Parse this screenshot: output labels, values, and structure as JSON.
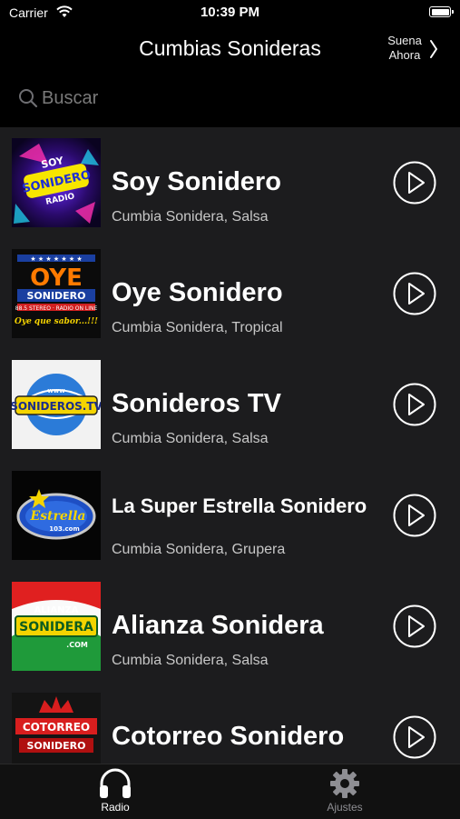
{
  "status_bar": {
    "carrier": "Carrier",
    "time": "10:39 PM"
  },
  "nav": {
    "title": "Cumbias Sonideras",
    "now_playing_line1": "Suena",
    "now_playing_line2": "Ahora"
  },
  "search": {
    "placeholder": "Buscar"
  },
  "stations": [
    {
      "name": "Soy Sonidero",
      "genres": "Cumbia Sonidera, Salsa",
      "logo_text": "SOY SONIDERO RADIO"
    },
    {
      "name": "Oye Sonidero",
      "genres": "Cumbia Sonidera, Tropical",
      "logo_text": "OYE SONIDERO",
      "logo_sub": "Oye que sabor...!!!"
    },
    {
      "name": "Sonideros TV",
      "genres": "Cumbia Sonidera, Salsa",
      "logo_text": "SONIDEROS.TV"
    },
    {
      "name": "La Super Estrella Sonidero",
      "genres": "Cumbia Sonidera, Grupera",
      "logo_text": "Estrella"
    },
    {
      "name": "Alianza Sonidera",
      "genres": "Cumbia Sonidera, Salsa",
      "logo_text": "ALIANZA SONIDERA"
    },
    {
      "name": "Cotorreo Sonidero",
      "genres": "",
      "logo_text": "COTORREO SONIDERO"
    }
  ],
  "tabs": [
    {
      "label": "Radio",
      "icon": "headphones-icon",
      "selected": true
    },
    {
      "label": "Ajustes",
      "icon": "gear-icon",
      "selected": false
    }
  ],
  "colors": {
    "background": "#000000",
    "list_background": "#1c1c1e",
    "selected_tab": "#ffffff",
    "unselected_tab": "#8e8e93"
  }
}
